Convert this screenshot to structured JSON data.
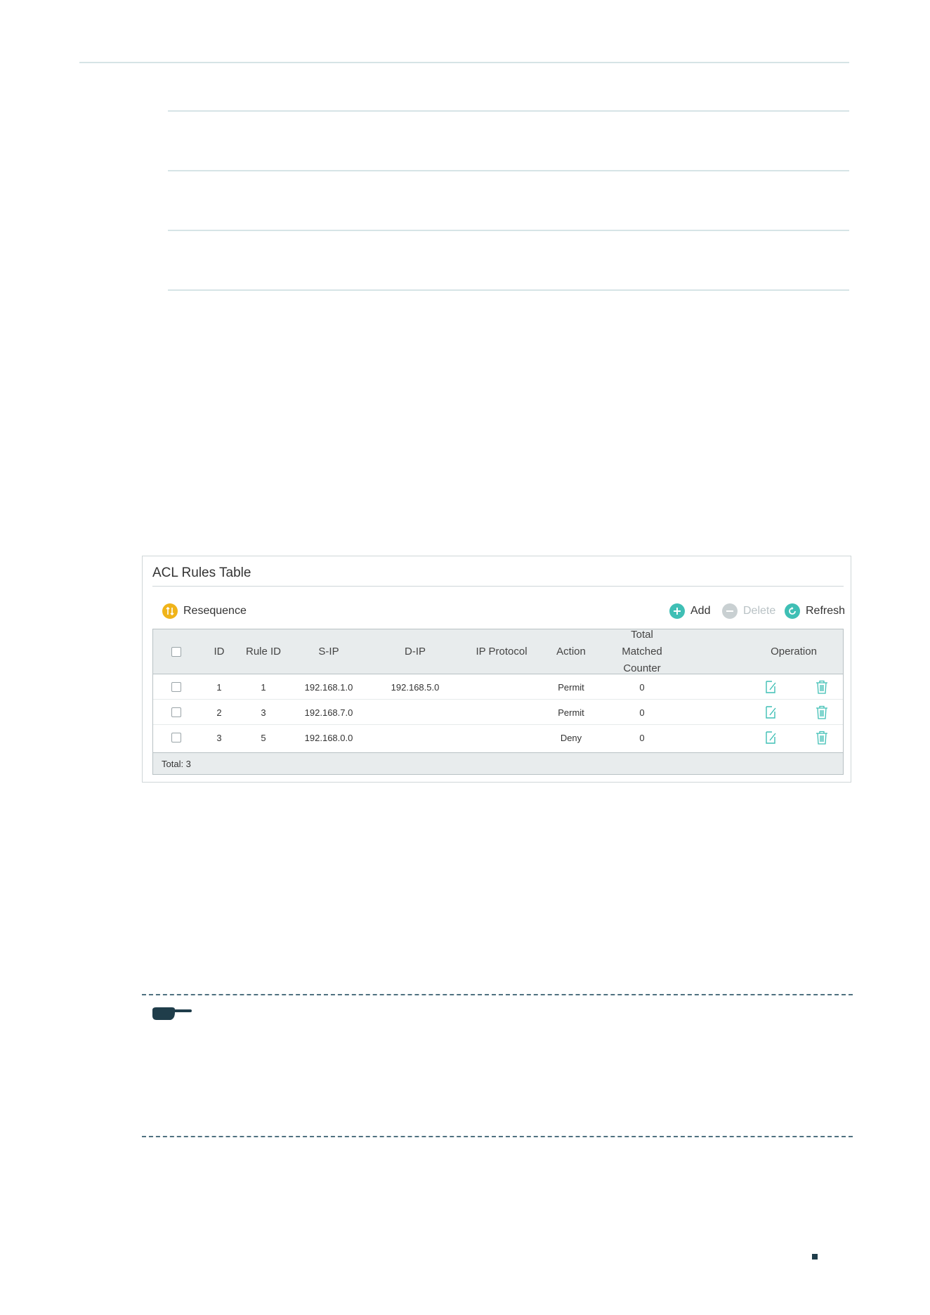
{
  "panel": {
    "title": "ACL Rules Table",
    "toolbar": {
      "resequence": "Resequence",
      "add": "Add",
      "delete": "Delete",
      "refresh": "Refresh"
    },
    "columns": [
      "ID",
      "Rule ID",
      "S-IP",
      "D-IP",
      "IP Protocol",
      "Action",
      "Total Matched Counter",
      "Operation"
    ],
    "rows": [
      {
        "id": "1",
        "rule_id": "1",
        "s_ip": "192.168.1.0",
        "d_ip": "192.168.5.0",
        "ip_protocol": "",
        "action": "Permit",
        "counter": "0"
      },
      {
        "id": "2",
        "rule_id": "3",
        "s_ip": "192.168.7.0",
        "d_ip": "",
        "ip_protocol": "",
        "action": "Permit",
        "counter": "0"
      },
      {
        "id": "3",
        "rule_id": "5",
        "s_ip": "192.168.0.0",
        "d_ip": "",
        "ip_protocol": "",
        "action": "Deny",
        "counter": "0"
      }
    ],
    "footer": "Total: 3"
  },
  "colors": {
    "resequence": "#f0b41a",
    "add": "#3fbfb5",
    "delete": "#c9d0d2",
    "refresh": "#3fbfb5",
    "operation_icon": "#3fbfb5"
  },
  "icons": {
    "resequence": "resequence-icon",
    "add": "plus-icon",
    "delete": "minus-icon",
    "refresh": "refresh-icon",
    "edit": "edit-icon",
    "trash": "trash-icon",
    "note": "pointing-hand-icon"
  }
}
